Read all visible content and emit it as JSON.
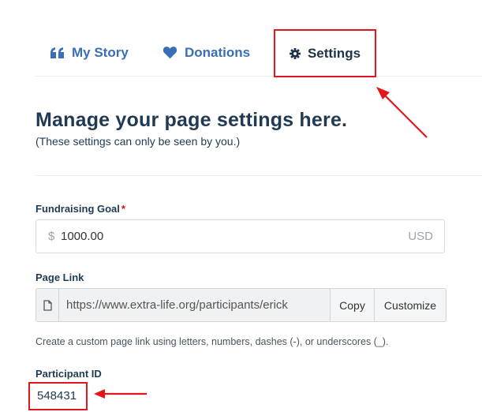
{
  "tabs": [
    {
      "label": "My Story",
      "icon": "quote-icon"
    },
    {
      "label": "Donations",
      "icon": "heart-icon"
    },
    {
      "label": "Settings",
      "icon": "gear-icon",
      "active": true
    }
  ],
  "heading": "Manage your page settings here.",
  "subheading": "(These settings can only be seen by you.)",
  "goal": {
    "label": "Fundraising Goal",
    "required_mark": "*",
    "prefix": "$",
    "value": "1000.00",
    "suffix": "USD"
  },
  "page_link": {
    "label": "Page Link",
    "value": "https://www.extra-life.org/participants/erick",
    "copy_label": "Copy",
    "customize_label": "Customize",
    "help": "Create a custom page link using letters, numbers, dashes (-), or underscores (_)."
  },
  "participant": {
    "label": "Participant ID",
    "value": "548431"
  },
  "colors": {
    "accent": "#3a6fb5",
    "heading": "#1f3a52",
    "annotation": "#e3161b"
  }
}
